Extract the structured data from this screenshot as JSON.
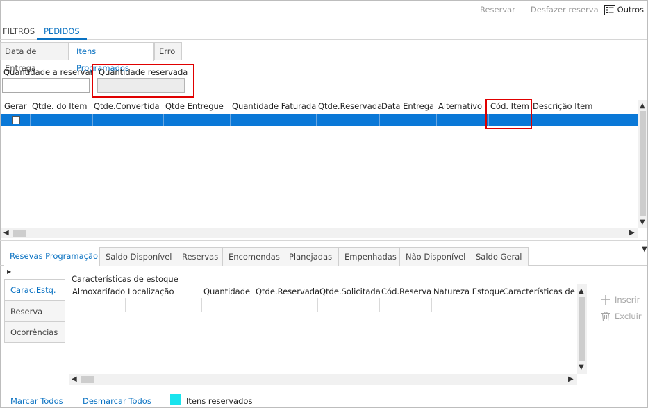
{
  "toolbar": {
    "reservar": "Reservar",
    "desfazer": "Desfazer reserva",
    "outros": "Outros"
  },
  "top_tabs": [
    "FILTROS",
    "PEDIDOS"
  ],
  "sub_tabs": [
    "Data de Entrega",
    "Itens Programados",
    "Erro"
  ],
  "fields": {
    "qtd_reservar_label": "Quantidade a reservar",
    "qtd_reservar_value": "",
    "qtd_reservada_label": "Quantidade reservada",
    "qtd_reservada_value": ""
  },
  "grid1": {
    "columns": [
      "Gerar",
      "Qtde. do Item",
      "Qtde.Convertida",
      "Qtde Entregue",
      "Quantidade Faturada",
      "Qtde.Reservada",
      "Data Entrega",
      "Alternativo",
      "Cód. Item",
      "Descrição Item"
    ],
    "rows": [
      {
        "gerar": false
      }
    ]
  },
  "bottom_tabs": [
    "Resevas Programação",
    "Saldo Disponível",
    "Reservas",
    "Encomendas",
    "Planejadas",
    "Empenhadas",
    "Não Disponível",
    "Saldo Geral"
  ],
  "side_tabs": [
    "Carac.Estq.",
    "Reserva",
    "Ocorrências"
  ],
  "grid2": {
    "title": "Características de estoque",
    "columns": [
      "Almoxarifado",
      "Localização",
      "Quantidade",
      "Qtde.Reservada",
      "Qtde.Solicitada",
      "Cód.Reserva",
      "Natureza Estoque",
      "Características de E"
    ]
  },
  "actions": {
    "inserir": "Inserir",
    "excluir": "Excluir"
  },
  "footer": {
    "marcar": "Marcar Todos",
    "desmarcar": "Desmarcar Todos",
    "legend": "Itens reservados",
    "legend_color": "#19e4ee"
  },
  "colors": {
    "accent": "#0a72c2",
    "selection": "#0a78d7",
    "highlight": "#e00000"
  }
}
